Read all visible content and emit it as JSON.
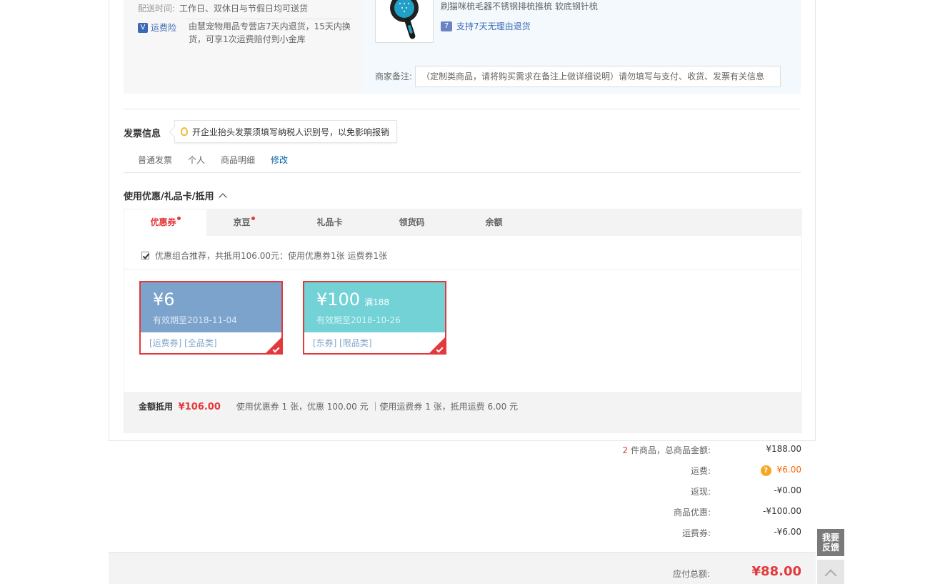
{
  "shipping": {
    "delivery_label": "配送时间:",
    "delivery_value": "工作日、双休日与节假日均可送货",
    "insurance_label": "运费险",
    "insurance_text": "由慧宠物用品专营店7天内退货，15天内换货，可享1次运费赔付到小金库"
  },
  "product": {
    "title": "刷猫咪梳毛器不锈钢排梳推梳 软底钢针梳",
    "return_policy": "支持7天无理由退货",
    "remark_label": "商家备注:",
    "remark_placeholder": "（定制类商品，请将购买需求在备注上做详细说明）请勿填写与支付、收货、发票有关信息"
  },
  "invoice": {
    "title": "发票信息",
    "tip": "开企业抬头发票须填写纳税人识别号，以免影响报销",
    "type": "普通发票",
    "header": "个人",
    "content": "商品明细",
    "edit_label": "修改"
  },
  "coupons": {
    "title": "使用优惠/礼品卡/抵用",
    "tabs": [
      {
        "label": "优惠券",
        "dot": true
      },
      {
        "label": "京豆",
        "dot": true
      },
      {
        "label": "礼品卡",
        "dot": false
      },
      {
        "label": "领货码",
        "dot": false
      },
      {
        "label": "余额",
        "dot": false
      }
    ],
    "combo_text": "优惠组合推荐，共抵用106.00元：使用优惠券1张 运费券1张",
    "cards": [
      {
        "amount": "¥6",
        "condition": "",
        "expiry": "有效期至2018-11-04",
        "tags": "[运费券] [全品类]",
        "color": "#7ba3cc"
      },
      {
        "amount": "¥100",
        "condition": "满188",
        "expiry": "有效期至2018-10-26",
        "tags": "[东券] [限品类]",
        "color": "#72d2d6"
      }
    ],
    "summary_label": "金额抵用",
    "summary_amount": "¥106.00",
    "summary_detail": "使用优惠券 1 张，优惠 100.00 元 ｜使用运费券 1 张，抵用运费 6.00 元"
  },
  "totals": {
    "items_count": "2",
    "items_label": "件商品，总商品金额:",
    "items_value": "¥188.00",
    "freight_label": "运费:",
    "freight_value": "¥6.00",
    "cashback_label": "返现:",
    "cashback_value": "-¥0.00",
    "discount_label": "商品优惠:",
    "discount_value": "-¥100.00",
    "freight_coupon_label": "运费券:",
    "freight_coupon_value": "-¥6.00",
    "payable_label": "应付总额:",
    "payable_value": "¥88.00"
  },
  "side": {
    "feedback_line1": "我要",
    "feedback_line2": "反馈"
  },
  "colors": {
    "accent": "#e4393c",
    "link": "#005ea7",
    "freight_orange": "#ff6600"
  }
}
